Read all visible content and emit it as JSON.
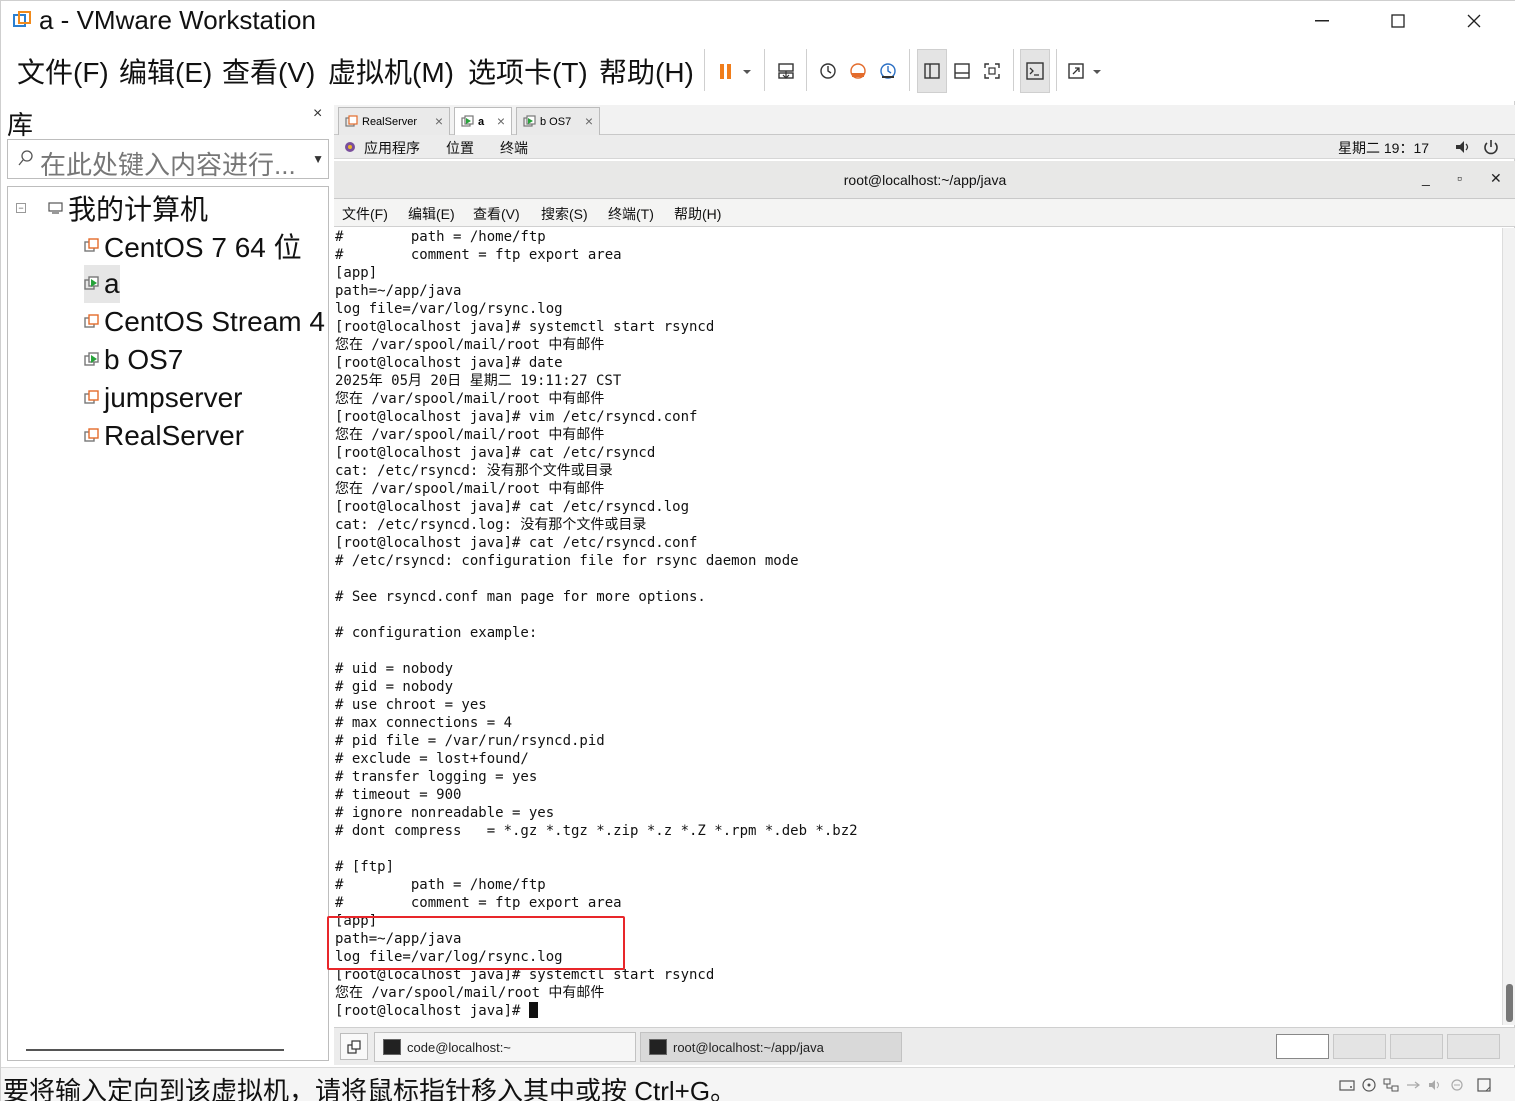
{
  "window": {
    "title": "a - VMware Workstation",
    "minimize": "—",
    "maximize": "☐",
    "close": "✕"
  },
  "menubar": {
    "items": [
      "文件(F)",
      "编辑(E)",
      "查看(V)",
      "虚拟机(M)",
      "选项卡(T)",
      "帮助(H)"
    ]
  },
  "library": {
    "title": "库",
    "close": "×",
    "search_placeholder": "在此处键入内容进行...",
    "tree": {
      "root": "我的计算机",
      "items": [
        "CentOS 7 64 位",
        "a",
        "CentOS Stream 4",
        "b OS7",
        "jumpserver",
        "RealServer"
      ]
    }
  },
  "tabs": [
    {
      "label": "RealServer",
      "close": "×"
    },
    {
      "label": "a",
      "close": "×"
    },
    {
      "label": "b OS7",
      "close": "×"
    }
  ],
  "gnome": {
    "applications": "应用程序",
    "places": "位置",
    "terminal": "终端",
    "clock": "星期二 19：17"
  },
  "terminal_window": {
    "title": "root@localhost:~/app/java",
    "min": "_",
    "max": "▫",
    "close": "✕",
    "menu": [
      "文件(F)",
      "编辑(E)",
      "查看(V)",
      "搜索(S)",
      "终端(T)",
      "帮助(H)"
    ],
    "lines": [
      "#        path = /home/ftp",
      "#        comment = ftp export area",
      "[app]",
      "path=~/app/java",
      "log file=/var/log/rsync.log",
      "[root@localhost java]# systemctl start rsyncd",
      "您在 /var/spool/mail/root 中有邮件",
      "[root@localhost java]# date",
      "2025年 05月 20日 星期二 19:11:27 CST",
      "您在 /var/spool/mail/root 中有邮件",
      "[root@localhost java]# vim /etc/rsyncd.conf",
      "您在 /var/spool/mail/root 中有邮件",
      "[root@localhost java]# cat /etc/rsyncd",
      "cat: /etc/rsyncd: 没有那个文件或目录",
      "您在 /var/spool/mail/root 中有邮件",
      "[root@localhost java]# cat /etc/rsyncd.log",
      "cat: /etc/rsyncd.log: 没有那个文件或目录",
      "[root@localhost java]# cat /etc/rsyncd.conf",
      "# /etc/rsyncd: configuration file for rsync daemon mode",
      "",
      "# See rsyncd.conf man page for more options.",
      "",
      "# configuration example:",
      "",
      "# uid = nobody",
      "# gid = nobody",
      "# use chroot = yes",
      "# max connections = 4",
      "# pid file = /var/run/rsyncd.pid",
      "# exclude = lost+found/",
      "# transfer logging = yes",
      "# timeout = 900",
      "# ignore nonreadable = yes",
      "# dont compress   = *.gz *.tgz *.zip *.z *.Z *.rpm *.deb *.bz2",
      "",
      "# [ftp]",
      "#        path = /home/ftp",
      "#        comment = ftp export area",
      "[app]",
      "path=~/app/java",
      "log file=/var/log/rsync.log",
      "[root@localhost java]# systemctl start rsyncd",
      "您在 /var/spool/mail/root 中有邮件"
    ],
    "prompt": "[root@localhost java]# "
  },
  "taskbar": {
    "items": [
      "code@localhost:~",
      "root@localhost:~/app/java"
    ]
  },
  "statusbar": {
    "message": "要将输入定向到该虚拟机，请将鼠标指针移入其中或按 Ctrl+G。"
  },
  "colors": {
    "accent_pause": "#f07d1b",
    "highlight_box": "#e8262a"
  }
}
